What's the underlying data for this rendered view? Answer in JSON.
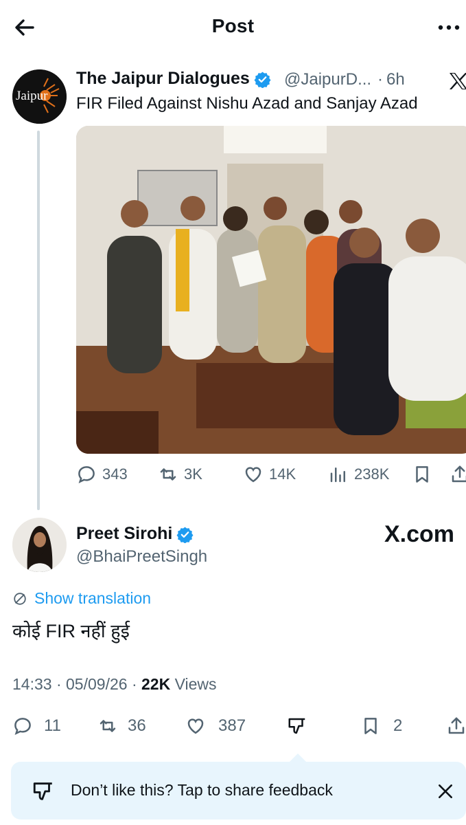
{
  "header": {
    "title": "Post"
  },
  "quoted_post": {
    "author_name": "The Jaipur Dialogues",
    "handle": "@JaipurD...",
    "separator": "·",
    "time": "6h",
    "text": "FIR Filed Against Nishu Azad and Sanjay Azad",
    "avatar_logo_text": "Jaipur",
    "stats": {
      "replies": "343",
      "reposts": "3K",
      "likes": "14K",
      "views": "238K"
    }
  },
  "reply_post": {
    "author_name": "Preet Sirohi",
    "handle": "@BhaiPreetSingh",
    "watermark": "X.com",
    "show_translation": "Show translation",
    "text": "कोई FIR नहीं हुई",
    "time": "14:33",
    "date": "05/09/26",
    "views_count": "22K",
    "views_label": "Views",
    "stats": {
      "replies": "11",
      "reposts": "36",
      "likes": "387",
      "bookmarks": "2"
    }
  },
  "feedback_banner": {
    "text": "Don’t like this? Tap to share feedback"
  },
  "colors": {
    "accent": "#1d9bf0",
    "secondary_text": "#536471",
    "banner_bg": "#e8f5fd"
  }
}
